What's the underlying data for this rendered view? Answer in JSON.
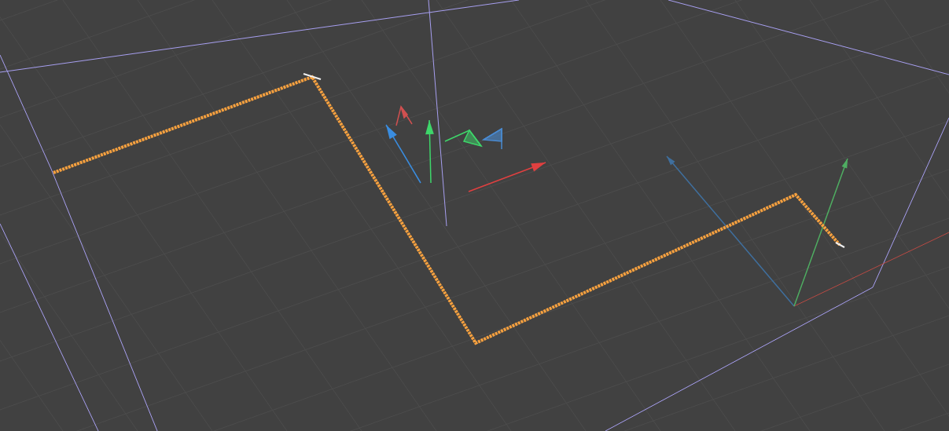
{
  "viewport": {
    "grid": true,
    "selected_spline": true
  }
}
